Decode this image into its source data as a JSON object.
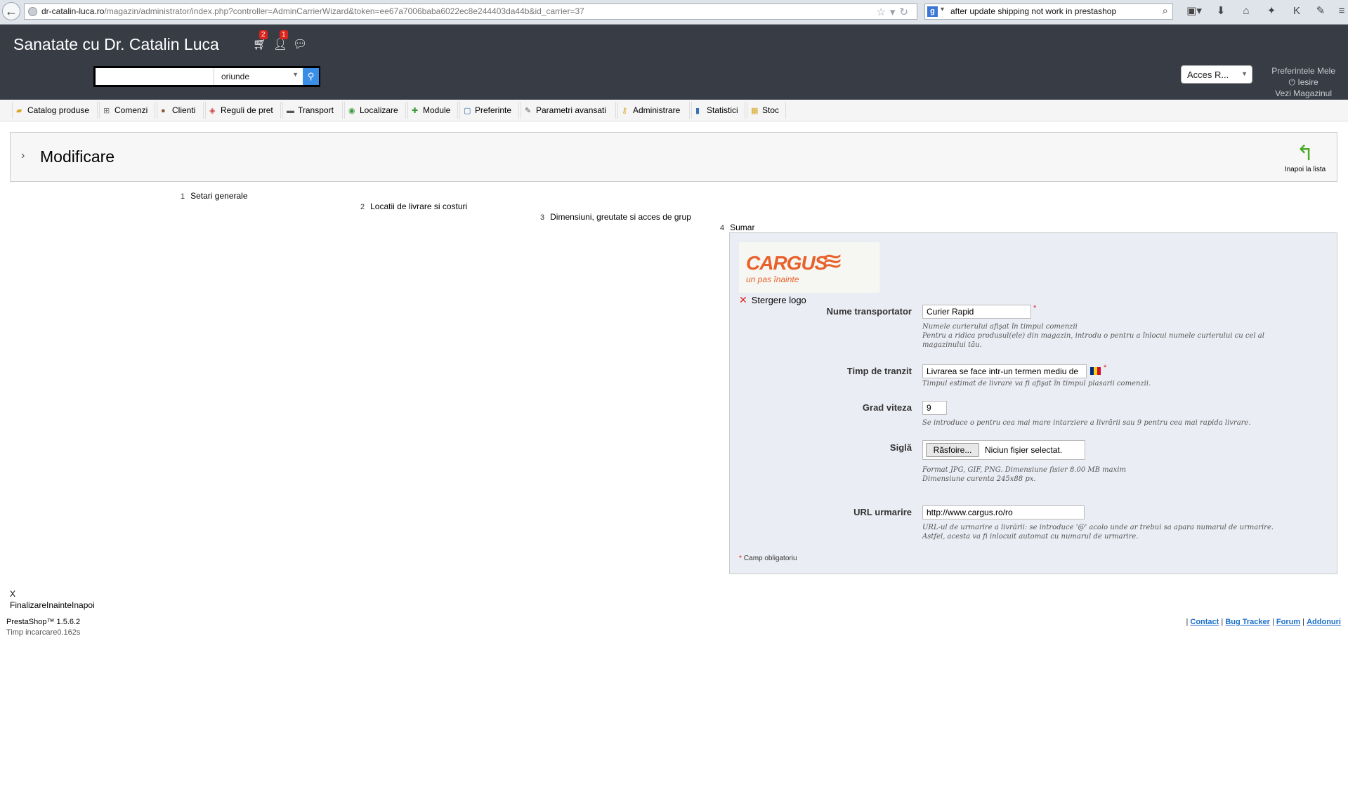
{
  "browser": {
    "url_host": "dr-catalin-luca.ro",
    "url_path": "/magazin/administrator/index.php?controller=AdminCarrierWizard&token=ee67a7006baba6022ec8e244403da44b&id_carrier=37",
    "search_engine": "g",
    "search_query": "after update shipping not work in prestashop"
  },
  "header": {
    "shop_name": "Sanatate cu Dr. Catalin Luca",
    "badges": {
      "orders": "2",
      "customers": "1"
    },
    "search": {
      "value": "",
      "scope": "oriunde"
    },
    "quick_access": "Acces R...",
    "user_links": {
      "preferences": "Preferintele Mele",
      "logout": "Iesire",
      "view_shop": "Vezi Magazinul"
    }
  },
  "tabs": [
    {
      "label": "Catalog produse"
    },
    {
      "label": "Comenzi"
    },
    {
      "label": "Clienti"
    },
    {
      "label": "Reguli de pret"
    },
    {
      "label": "Transport"
    },
    {
      "label": "Localizare"
    },
    {
      "label": "Module"
    },
    {
      "label": "Preferinte"
    },
    {
      "label": "Parametri avansati"
    },
    {
      "label": "Administrare"
    },
    {
      "label": "Statistici"
    },
    {
      "label": "Stoc"
    }
  ],
  "toolbar": {
    "title": "Modificare",
    "back_label": "Inapoi la lista"
  },
  "steps": [
    {
      "num": "1",
      "label": "Setari generale"
    },
    {
      "num": "2",
      "label": "Locatii de livrare si costuri"
    },
    {
      "num": "3",
      "label": "Dimensiuni, greutate si acces de grup"
    },
    {
      "num": "4",
      "label": "Sumar"
    }
  ],
  "form": {
    "logo": {
      "brand": "CARGUS",
      "tagline": "un pas înainte"
    },
    "delete_logo": "Stergere logo",
    "name": {
      "label": "Nume transportator",
      "value": "Curier Rapid",
      "hint1": "Numele curierului afişat în timpul comenzii",
      "hint2": "Pentru a ridica produsul(ele) din magazin, introdu o pentru a înlocui numele curierului cu cel al magazinului tău."
    },
    "transit": {
      "label": "Timp de tranzit",
      "value": "Livrarea se face intr-un termen mediu de",
      "hint": "Timpul estimat de livrare va fi afişat în timpul plasarii comenzii."
    },
    "speed": {
      "label": "Grad viteza",
      "value": "9",
      "hint": "Se introduce o pentru cea mai mare intarziere a livrării sau 9 pentru cea mai rapida livrare."
    },
    "logo_field": {
      "label": "Siglă",
      "button": "Răsfoire...",
      "file_text": "Niciun fişier selectat.",
      "hint1": "Format JPG, GIF, PNG. Dimensiune fisier 8.00 MB maxim",
      "hint2": "Dimensiune curenta 245x88 px."
    },
    "tracking": {
      "label": "URL urmarire",
      "value": "http://www.cargus.ro/ro",
      "hint1": "URL-ul de urmarire a livrării: se introduce '@' acolo unde ar trebui sa apara numarul de urmarire.",
      "hint2": "Astfel, acesta va fi inlocuit automat cu numarul de urmarire."
    },
    "required_note": "Camp obligatoriu"
  },
  "footer": {
    "close": "X",
    "nav": "FinalizareInainteInapoi",
    "version": "PrestaShop™ 1.5.6.2",
    "load_time": "Timp incarcare0.162s",
    "links": [
      "Contact",
      "Bug Tracker",
      "Forum",
      "Addonuri"
    ]
  },
  "colors": {
    "header_bg": "#383d45",
    "accent_blue": "#3a8ee6",
    "panel_bg": "#ebedf4",
    "required_red": "#d22222",
    "cargus_orange": "#e8602a"
  }
}
